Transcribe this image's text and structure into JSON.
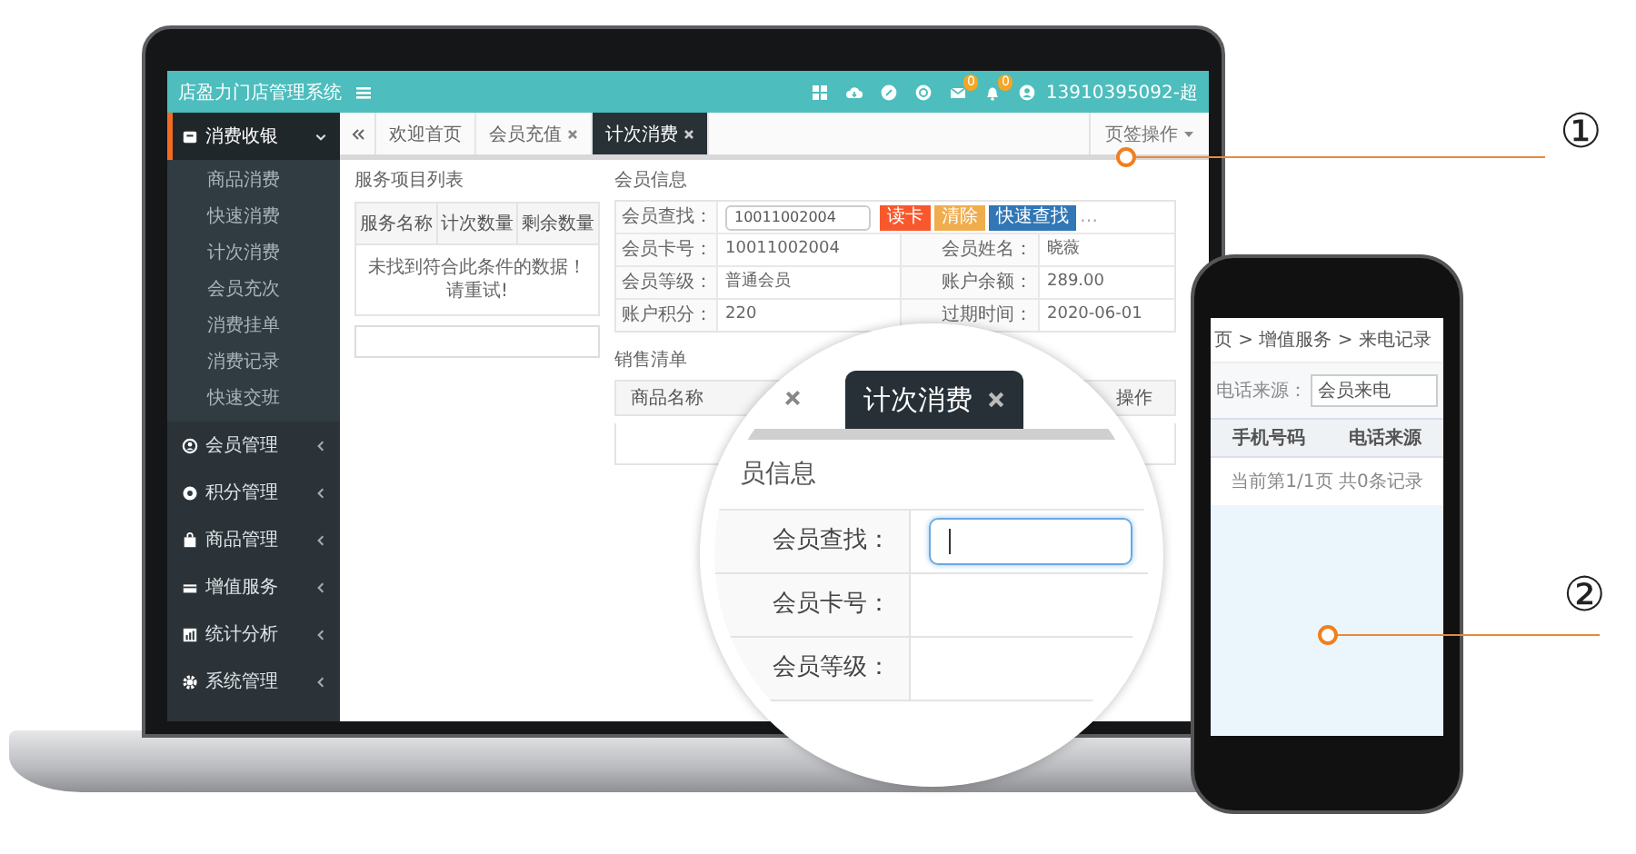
{
  "header": {
    "title": "店盈力门店管理系统",
    "badges": [
      "0",
      "0"
    ],
    "user": "13910395092-超"
  },
  "sidebar": {
    "group": {
      "label": "消费收银",
      "expanded": true,
      "items": [
        "商品消费",
        "快速消费",
        "计次消费",
        "会员充次",
        "消费挂单",
        "消费记录",
        "快速交班"
      ]
    },
    "groups": [
      {
        "label": "会员管理",
        "expanded": false
      },
      {
        "label": "积分管理",
        "expanded": false
      },
      {
        "label": "商品管理",
        "expanded": false
      },
      {
        "label": "增值服务",
        "expanded": false
      },
      {
        "label": "统计分析",
        "expanded": false
      },
      {
        "label": "系统管理",
        "expanded": false
      }
    ]
  },
  "tabs": [
    {
      "label": "欢迎首页",
      "selected": false,
      "closable": false
    },
    {
      "label": "会员充值",
      "selected": false,
      "closable": true
    },
    {
      "label": "计次消费",
      "selected": true,
      "closable": true
    }
  ],
  "tab_menu": "页签操作",
  "service_panel": {
    "title": "服务项目列表",
    "columns": [
      "服务名称",
      "计次数量",
      "剩余数量"
    ],
    "empty_message": "未找到符合此条件的数据！请重试!"
  },
  "member_panel": {
    "title": "会员信息",
    "search": {
      "label": "会员查找：",
      "value": "10011002004"
    },
    "buttons": [
      {
        "label": "读卡",
        "kind": "danger"
      },
      {
        "label": "清除",
        "kind": "warning"
      },
      {
        "label": "快速查找",
        "kind": "primary"
      }
    ],
    "more": "…",
    "fields": [
      {
        "label": "会员卡号：",
        "value": "10011002004"
      },
      {
        "label": "会员姓名：",
        "value": "晓薇"
      },
      {
        "label": "会员等级：",
        "value": "普通会员"
      },
      {
        "label": "账户余额：",
        "value": "289.00"
      },
      {
        "label": "账户积分：",
        "value": "220"
      },
      {
        "label": "过期时间：",
        "value": "2020-06-01"
      }
    ]
  },
  "sales_panel": {
    "title": "销售清单",
    "columns": [
      "商品名称",
      "操作"
    ]
  },
  "magnifier": {
    "tab": "计次消费",
    "section": "员信息",
    "rows": [
      {
        "label": "会员查找：",
        "kind": "input",
        "focused": true
      },
      {
        "label": "会员卡号：",
        "kind": "text"
      },
      {
        "label": "会员等级：",
        "kind": "text"
      }
    ]
  },
  "phone": {
    "breadcrumb": "页 > 增值服务 > 来电记录",
    "filter": {
      "label": "电话来源：",
      "value": "会员来电"
    },
    "columns": [
      "手机号码",
      "电话来源"
    ],
    "pager": "当前第1/1页 共0条记录"
  },
  "callouts": [
    "①",
    "②"
  ]
}
